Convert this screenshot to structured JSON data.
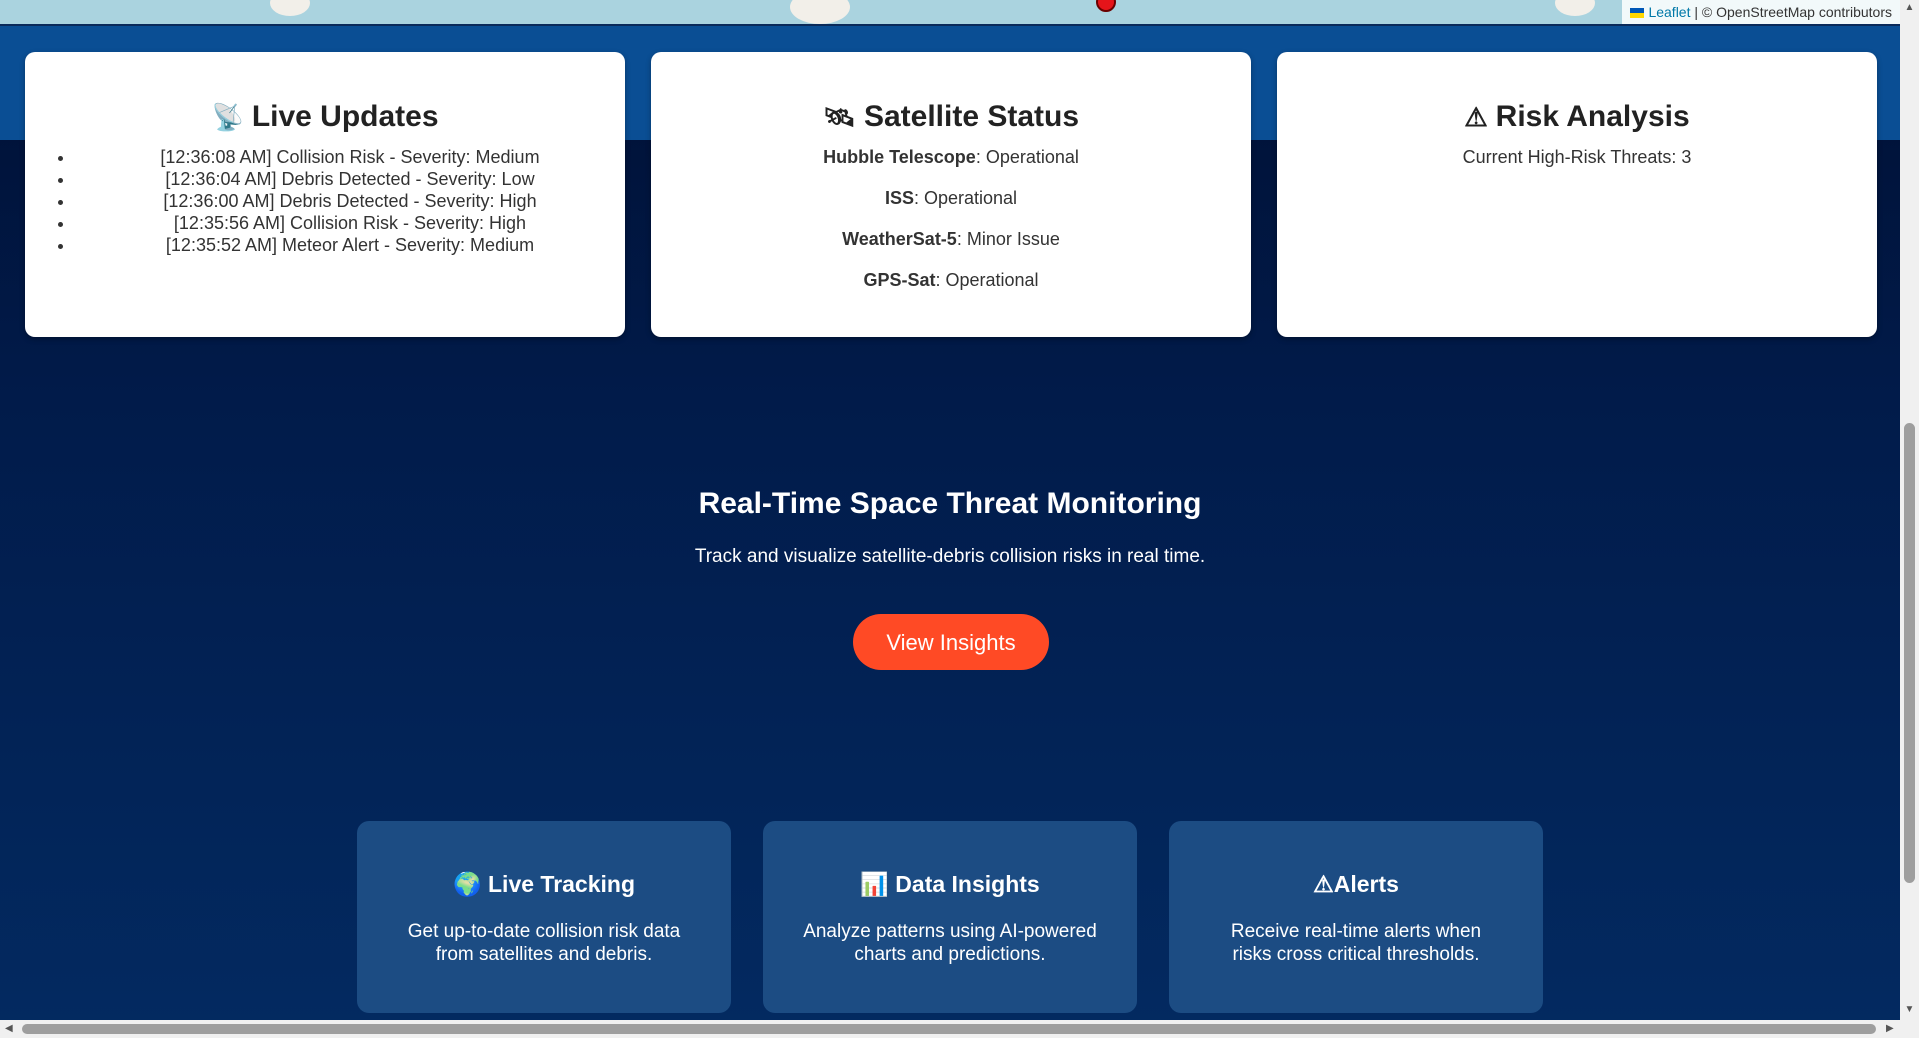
{
  "map": {
    "attribution_link": "Leaflet",
    "attribution_text": "| © OpenStreetMap contributors"
  },
  "live_updates": {
    "icon": "satellite-antenna-icon",
    "title": "Live Updates",
    "items": [
      "[12:36:08 AM] Collision Risk - Severity: Medium",
      "[12:36:04 AM] Debris Detected - Severity: Low",
      "[12:36:00 AM] Debris Detected - Severity: High",
      "[12:35:56 AM] Collision Risk - Severity: High",
      "[12:35:52 AM] Meteor Alert - Severity: Medium"
    ]
  },
  "satellite_status": {
    "icon": "satellite-icon",
    "title": "Satellite Status",
    "items": [
      {
        "name": "Hubble Telescope",
        "status": ": Operational"
      },
      {
        "name": "ISS",
        "status": ": Operational"
      },
      {
        "name": "WeatherSat-5",
        "status": ": Minor Issue"
      },
      {
        "name": "GPS-Sat",
        "status": ": Operational"
      }
    ]
  },
  "risk_analysis": {
    "icon": "warning-icon",
    "title": "Risk Analysis",
    "text": "Current High-Risk Threats: 3"
  },
  "hero": {
    "title": "Real-Time Space Threat Monitoring",
    "subtitle": "Track and visualize satellite-debris collision risks in real time.",
    "cta_label": "View Insights"
  },
  "features": [
    {
      "icon": "globe-icon",
      "title": "Live Tracking",
      "text": "Get up-to-date collision risk data from satellites and debris."
    },
    {
      "icon": "bar-chart-icon",
      "title": "Data Insights",
      "text": "Analyze patterns using AI-powered charts and predictions."
    },
    {
      "icon": "warning-icon",
      "title": "Alerts",
      "text": "Receive real-time alerts when risks cross critical thresholds."
    }
  ],
  "colors": {
    "cta": "#ff4a25",
    "feature_card": "#1c4c83",
    "band": "#0a4e94",
    "marker": "#e5141a"
  }
}
